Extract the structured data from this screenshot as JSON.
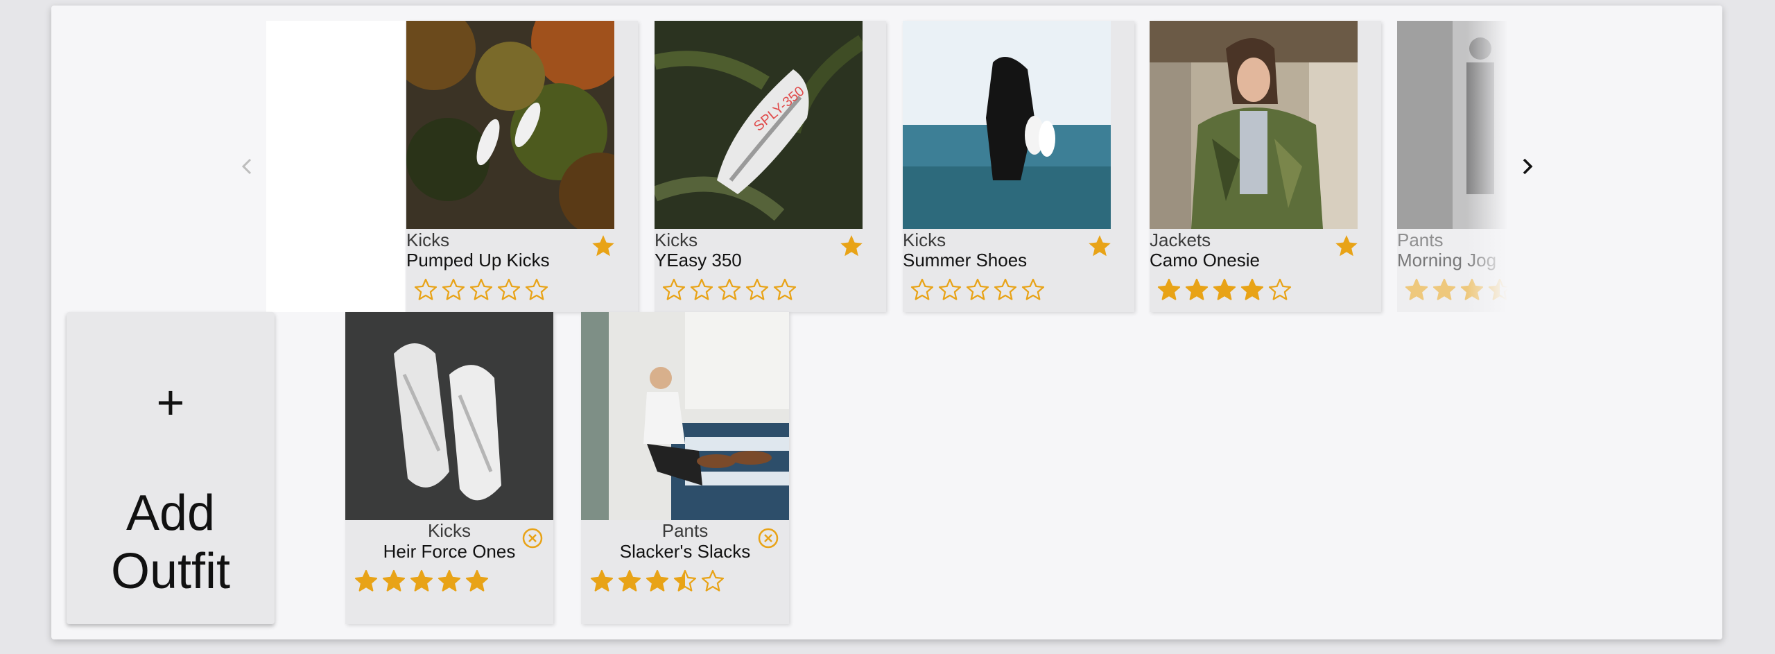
{
  "related": {
    "prev_icon": "chevron-left-icon",
    "next_icon": "chevron-right-icon",
    "items": [
      {
        "category": "Kicks",
        "name": "Pumped Up Kicks",
        "rating": 0,
        "favorite_icon": "star-icon",
        "image": "sneakers-in-forest"
      },
      {
        "category": "Kicks",
        "name": "YEasy 350",
        "rating": 0,
        "favorite_icon": "star-icon",
        "image": "white-sneaker-on-ferns"
      },
      {
        "category": "Kicks",
        "name": "Summer Shoes",
        "rating": 0,
        "favorite_icon": "star-icon",
        "image": "person-in-sea-holding-shoes"
      },
      {
        "category": "Jackets",
        "name": "Camo Onesie",
        "rating": 4,
        "favorite_icon": "star-icon",
        "image": "woman-in-camo-jacket"
      },
      {
        "category": "Pants",
        "name": "Morning Jog",
        "rating": 3.5,
        "favorite_icon": "star-icon",
        "image": "person-in-doorway"
      }
    ]
  },
  "outfit": {
    "add_button": {
      "plus": "+",
      "label": "Add Outfit"
    },
    "items": [
      {
        "category": "Kicks",
        "name": "Heir Force Ones",
        "rating": 5,
        "remove_icon": "close-circle-icon",
        "image": "white-sneakers-on-dark"
      },
      {
        "category": "Pants",
        "name": "Slacker's Slacks",
        "rating": 3.5,
        "remove_icon": "close-circle-icon",
        "image": "man-sitting-in-cafe"
      }
    ]
  },
  "colors": {
    "star": "#e8a317",
    "card": "#e8e8ea",
    "panel": "#f6f6f8"
  }
}
